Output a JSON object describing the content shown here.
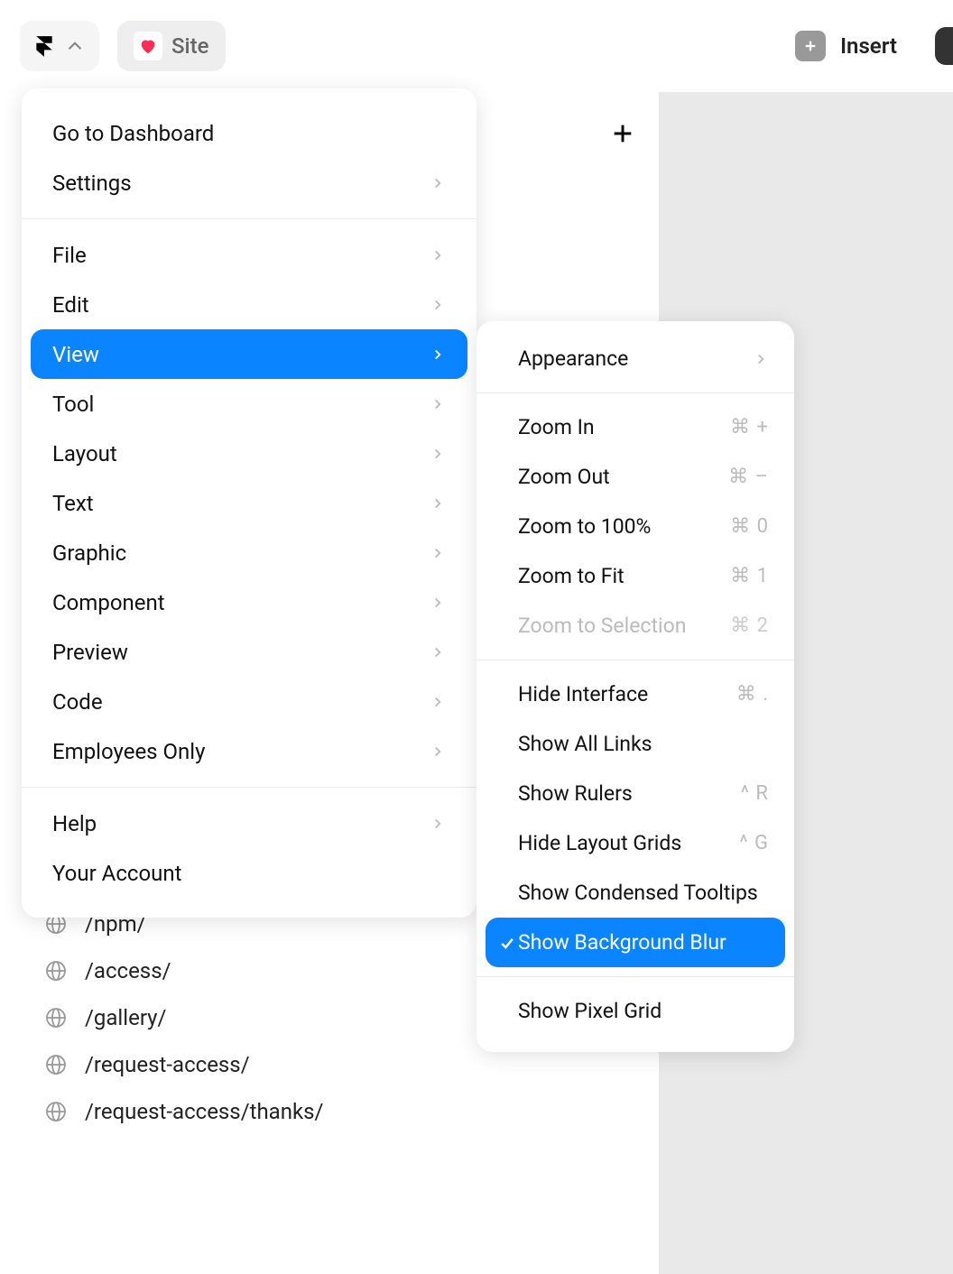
{
  "topbar": {
    "site_label": "Site",
    "insert_label": "Insert"
  },
  "menu": {
    "group1": [
      {
        "label": "Go to Dashboard",
        "chevron": false
      },
      {
        "label": "Settings",
        "chevron": true
      }
    ],
    "group2": [
      {
        "label": "File",
        "chevron": true,
        "active": false
      },
      {
        "label": "Edit",
        "chevron": true,
        "active": false
      },
      {
        "label": "View",
        "chevron": true,
        "active": true
      },
      {
        "label": "Tool",
        "chevron": true,
        "active": false
      },
      {
        "label": "Layout",
        "chevron": true,
        "active": false
      },
      {
        "label": "Text",
        "chevron": true,
        "active": false
      },
      {
        "label": "Graphic",
        "chevron": true,
        "active": false
      },
      {
        "label": "Component",
        "chevron": true,
        "active": false
      },
      {
        "label": "Preview",
        "chevron": true,
        "active": false
      },
      {
        "label": "Code",
        "chevron": true,
        "active": false
      },
      {
        "label": "Employees Only",
        "chevron": true,
        "active": false
      }
    ],
    "group3": [
      {
        "label": "Help",
        "chevron": true
      },
      {
        "label": "Your Account",
        "chevron": false
      }
    ]
  },
  "submenu": {
    "group1": [
      {
        "label": "Appearance",
        "chevron": true
      }
    ],
    "group2": [
      {
        "label": "Zoom In",
        "shortcut": "⌘ +",
        "disabled": false
      },
      {
        "label": "Zoom Out",
        "shortcut": "⌘ –",
        "disabled": false
      },
      {
        "label": "Zoom to 100%",
        "shortcut": "⌘ 0",
        "disabled": false
      },
      {
        "label": "Zoom to Fit",
        "shortcut": "⌘ 1",
        "disabled": false
      },
      {
        "label": "Zoom to Selection",
        "shortcut": "⌘ 2",
        "disabled": true
      }
    ],
    "group3": [
      {
        "label": "Hide Interface",
        "shortcut": "⌘ ."
      },
      {
        "label": "Show All Links",
        "shortcut": ""
      },
      {
        "label": "Show Rulers",
        "shortcut": "^ R"
      },
      {
        "label": "Hide Layout Grids",
        "shortcut": "^ G"
      },
      {
        "label": "Show Condensed Tooltips",
        "shortcut": ""
      },
      {
        "label": "Show Background Blur",
        "shortcut": "",
        "active": true,
        "checked": true
      }
    ],
    "group4": [
      {
        "label": "Show Pixel Grid",
        "shortcut": ""
      }
    ]
  },
  "sidebar": {
    "paths": [
      "/npm/",
      "/access/",
      "/gallery/",
      "/request-access/",
      "/request-access/thanks/"
    ]
  }
}
